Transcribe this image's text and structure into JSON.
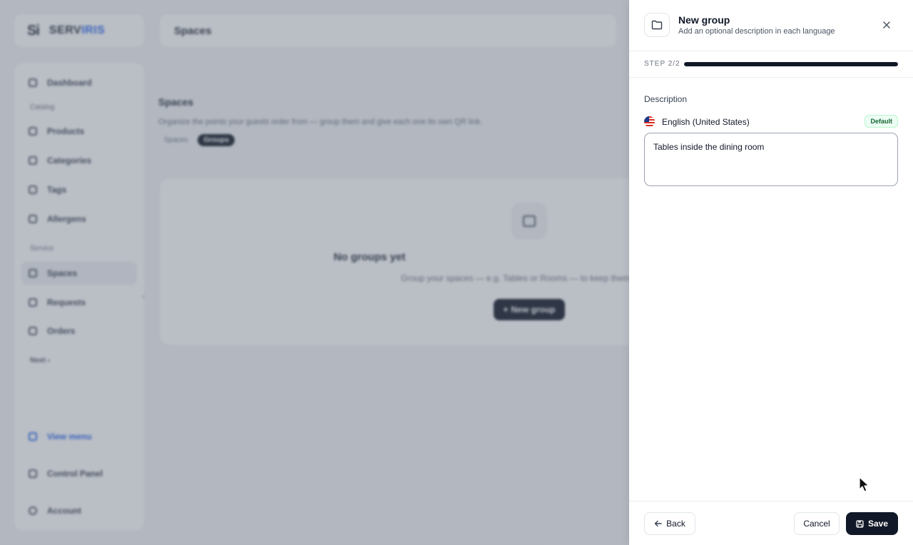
{
  "background": {
    "logo": {
      "mark": "Si",
      "text_a": "SERV",
      "text_b": "IRIS"
    },
    "topbar_title": "Spaces",
    "sidebar": {
      "items": [
        {
          "label": "Dashboard"
        },
        {
          "section": "Catalog"
        },
        {
          "label": "Products"
        },
        {
          "label": "Categories"
        },
        {
          "label": "Tags"
        },
        {
          "label": "Allergens"
        },
        {
          "section": "Service"
        },
        {
          "label": "Spaces",
          "active": true
        },
        {
          "label": "Requests"
        },
        {
          "label": "Orders"
        },
        {
          "section": "Next"
        }
      ],
      "bottom": [
        {
          "label": "View menu"
        },
        {
          "label": "Control Panel"
        },
        {
          "label": "Account"
        }
      ]
    },
    "page_title": "Spaces",
    "page_subtitle": "Organize the points your guests order from — group them and give each one its own QR link.",
    "tabs": [
      "Spaces",
      "Groups"
    ],
    "empty_state": {
      "title": "No groups yet",
      "subtitle": "Group your spaces — e.g. Tables or Rooms — to keep them",
      "button": "New group"
    }
  },
  "drawer": {
    "title": "New group",
    "subtitle": "Add an optional description in each language",
    "step_label": "STEP 2/2",
    "progress": 1.0,
    "field_label": "Description",
    "language": "English (United States)",
    "language_badge": "Default",
    "description_value": "Tables inside the dining room",
    "buttons": {
      "back": "Back",
      "cancel": "Cancel",
      "save": "Save"
    }
  }
}
